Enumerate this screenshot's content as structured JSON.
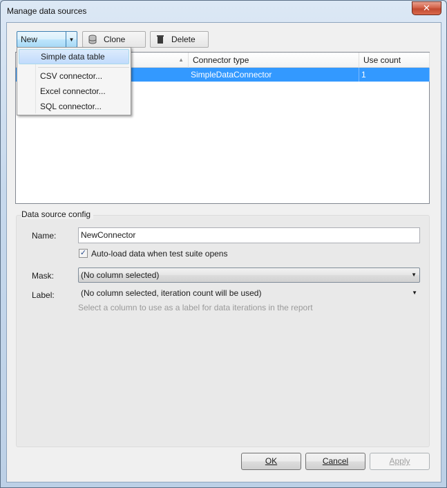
{
  "window": {
    "title": "Manage data sources",
    "close_glyph": "✕"
  },
  "toolbar": {
    "new_label": "New",
    "clone_label": "Clone",
    "delete_label": "Delete"
  },
  "menu": {
    "items": [
      "Simple data table",
      "CSV connector...",
      "Excel connector...",
      "SQL connector..."
    ]
  },
  "grid": {
    "columns": [
      "",
      "Connector type",
      "Use count"
    ],
    "rows": [
      {
        "name": "",
        "connector_type": "SimpleDataConnector",
        "use_count": "1",
        "selected": true
      }
    ]
  },
  "config": {
    "group_title": "Data source config",
    "name_label": "Name:",
    "name_value": "NewConnector",
    "autoload_label": "Auto-load data when test suite opens",
    "autoload_checked": true,
    "mask_label": "Mask:",
    "mask_value": "(No column selected)",
    "label_label": "Label:",
    "label_value": "(No column selected, iteration count will be used)",
    "label_hint": "Select a column to use as a label for data iterations in the report"
  },
  "buttons": {
    "ok": "OK",
    "cancel": "Cancel",
    "apply": "Apply"
  },
  "icons": {
    "clone": "database-stack-icon",
    "delete": "trash-icon",
    "dropdown": "chevron-down-icon",
    "sort": "sort-ascending-icon",
    "check": "checkmark-icon"
  },
  "colors": {
    "selection": "#3399ff",
    "menu_highlight": "#c1dbfc",
    "close_button": "#c24a31"
  }
}
